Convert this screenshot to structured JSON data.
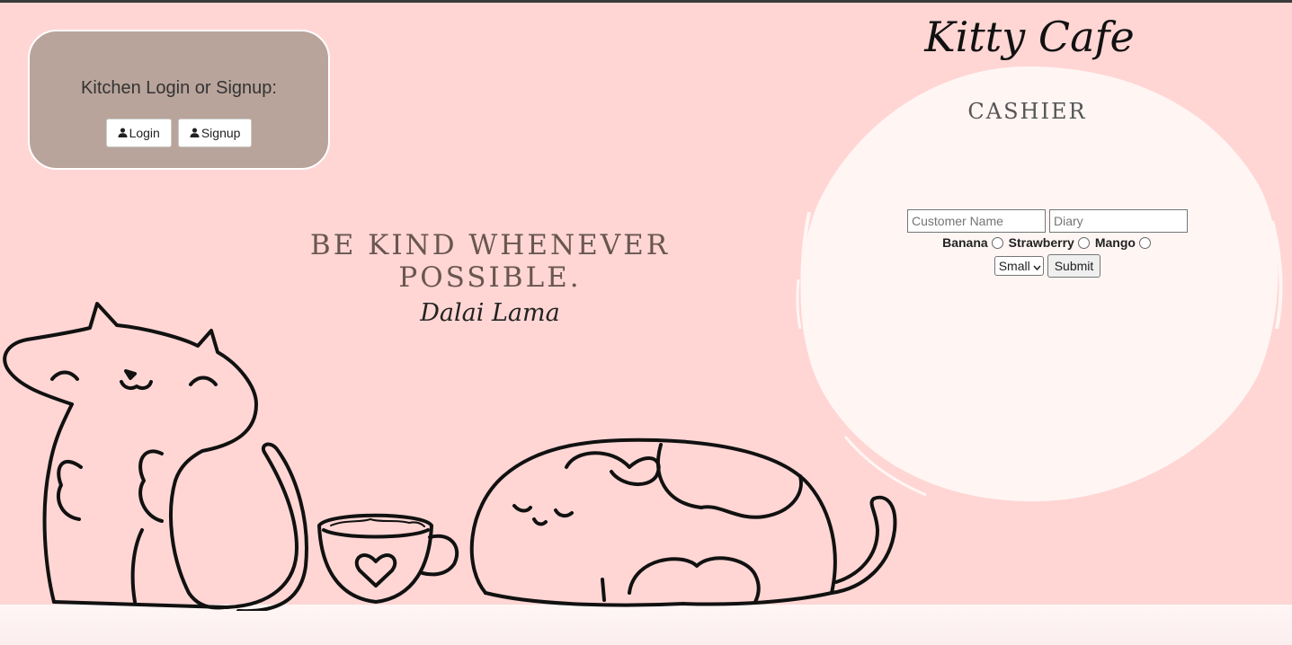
{
  "kitchen": {
    "title": "Kitchen Login or Signup:",
    "login_label": "Login",
    "signup_label": "Signup",
    "icon": "user-icon"
  },
  "quote": {
    "text": "BE KIND WHENEVER POSSIBLE.",
    "author": "Dalai Lama"
  },
  "brand": {
    "title": "Kitty Cafe"
  },
  "cashier": {
    "title": "CASHIER",
    "customer_placeholder": "Customer Name",
    "diary_placeholder": "Diary",
    "flavors": [
      "Banana",
      "Strawberry",
      "Mango"
    ],
    "size_selected": "Small",
    "submit_label": "Submit"
  },
  "colors": {
    "background": "#ffd6d4",
    "login_card": "#b9a49b",
    "cashier_bubble": "#fff6f4"
  }
}
